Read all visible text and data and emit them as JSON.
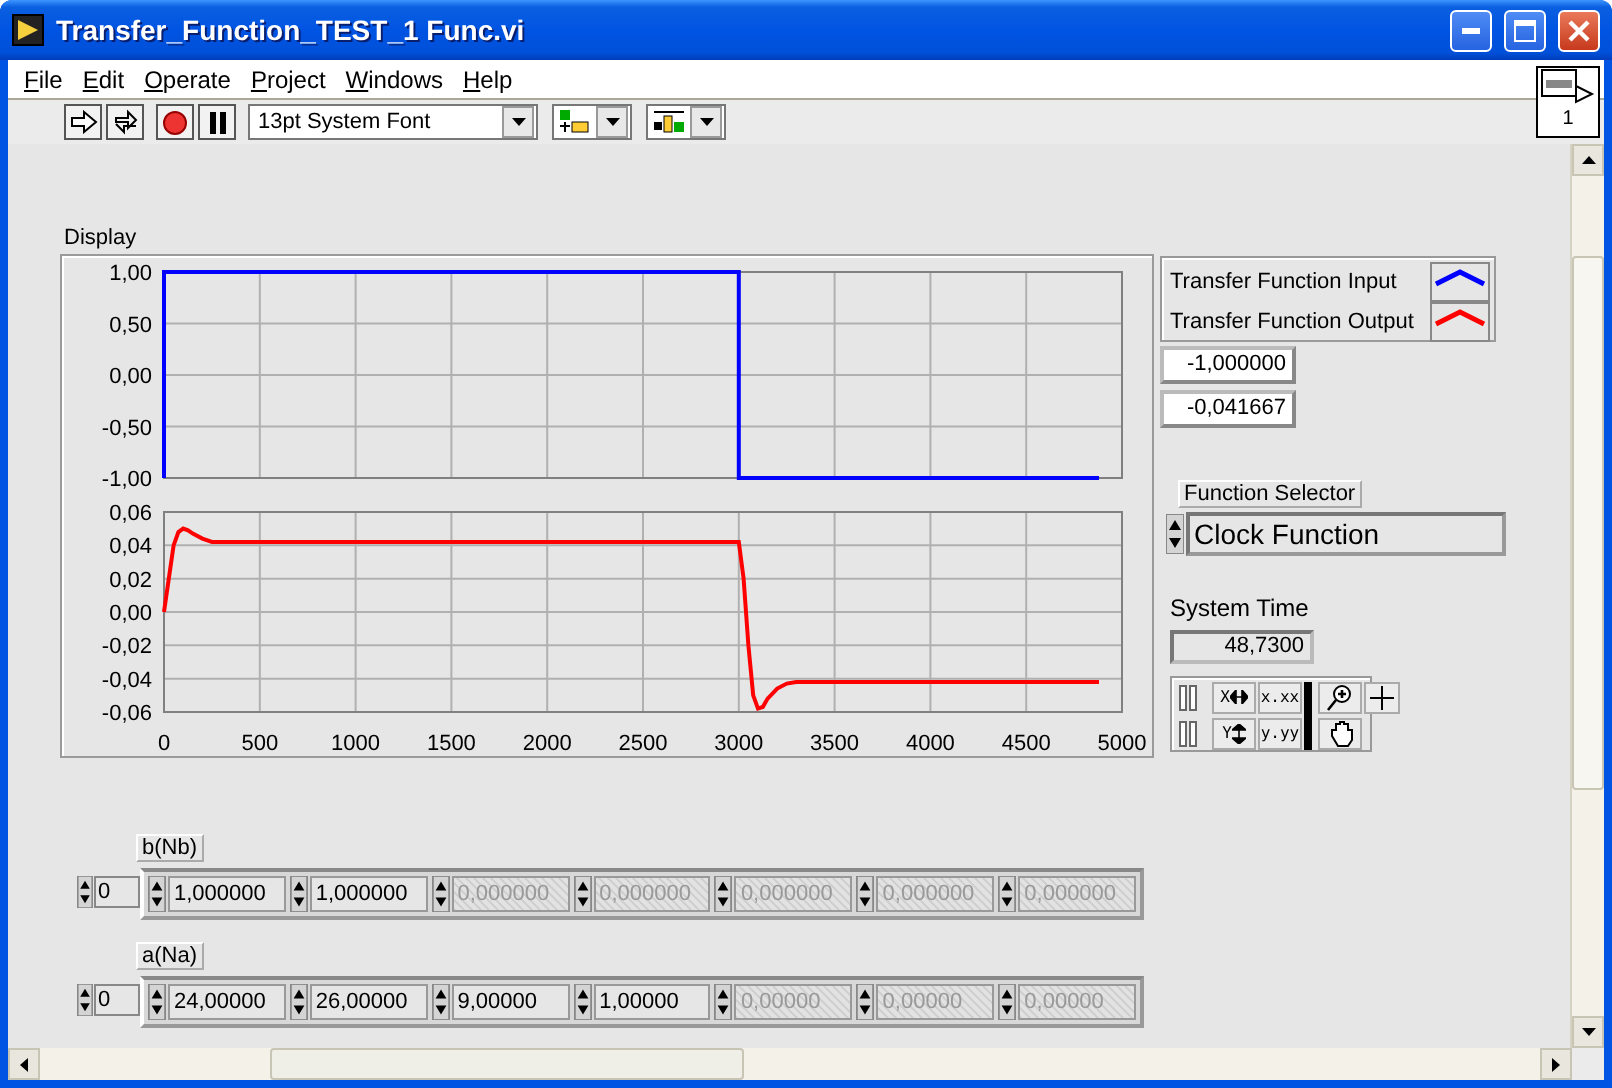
{
  "window": {
    "title": "Transfer_Function_TEST_1 Func.vi"
  },
  "menu": [
    "File",
    "Edit",
    "Operate",
    "Project",
    "Windows",
    "Help"
  ],
  "toolbar": {
    "font": "13pt System Font"
  },
  "vi_icon": {
    "label": "1"
  },
  "display": {
    "label": "Display",
    "plots": [
      {
        "chart_data": {
          "type": "line",
          "grid": true,
          "xlim": [
            0,
            5000
          ],
          "ylim": [
            -1,
            1
          ],
          "yticks": [
            {
              "value": 1,
              "label": "1,00"
            },
            {
              "value": 0.5,
              "label": "0,50"
            },
            {
              "value": 0,
              "label": "0,00"
            },
            {
              "value": -0.5,
              "label": "-0,50"
            },
            {
              "value": -1,
              "label": "-1,00"
            }
          ],
          "x": [
            0,
            0,
            3000,
            3000,
            4880
          ],
          "series": [
            {
              "name": "Transfer Function Input",
              "color": "#0000ff",
              "values": [
                -1,
                1,
                1,
                -1,
                -1
              ]
            }
          ]
        }
      },
      {
        "chart_data": {
          "type": "line",
          "grid": true,
          "xlim": [
            0,
            5000
          ],
          "ylim": [
            -0.06,
            0.06
          ],
          "xticks": [
            0,
            500,
            1000,
            1500,
            2000,
            2500,
            3000,
            3500,
            4000,
            4500,
            5000
          ],
          "yticks": [
            {
              "value": 0.06,
              "label": "0,06"
            },
            {
              "value": 0.04,
              "label": "0,04"
            },
            {
              "value": 0.02,
              "label": "0,02"
            },
            {
              "value": 0,
              "label": "0,00"
            },
            {
              "value": -0.02,
              "label": "-0,02"
            },
            {
              "value": -0.04,
              "label": "-0,04"
            },
            {
              "value": -0.06,
              "label": "-0,06"
            }
          ],
          "x": [
            0,
            25,
            50,
            75,
            100,
            125,
            150,
            200,
            250,
            300,
            3000,
            3025,
            3050,
            3075,
            3100,
            3125,
            3150,
            3200,
            3250,
            3300,
            3400,
            4880
          ],
          "series": [
            {
              "name": "Transfer Function Output",
              "color": "#ff0000",
              "values": [
                0,
                0.02,
                0.04,
                0.048,
                0.05,
                0.049,
                0.047,
                0.044,
                0.042,
                0.042,
                0.042,
                0.02,
                -0.02,
                -0.05,
                -0.058,
                -0.057,
                -0.052,
                -0.046,
                -0.043,
                -0.042,
                -0.042,
                -0.042
              ]
            }
          ]
        }
      }
    ]
  },
  "cursor_readouts": [
    "-1,000000",
    "-0,041667"
  ],
  "function_selector": {
    "label": "Function Selector",
    "value": "Clock Function"
  },
  "system_time": {
    "label": "System Time",
    "value": "48,7300"
  },
  "graph_palette": {
    "x_scale": "X",
    "y_scale": "Y",
    "x_format": "x.xx",
    "y_format": "y.yy"
  },
  "arrays": [
    {
      "label": "b(Nb)",
      "index": "0",
      "elements": [
        {
          "value": "1,000000",
          "disabled": false
        },
        {
          "value": "1,000000",
          "disabled": false
        },
        {
          "value": "0,000000",
          "disabled": true
        },
        {
          "value": "0,000000",
          "disabled": true
        },
        {
          "value": "0,000000",
          "disabled": true
        },
        {
          "value": "0,000000",
          "disabled": true
        },
        {
          "value": "0,000000",
          "disabled": true
        }
      ]
    },
    {
      "label": "a(Na)",
      "index": "0",
      "elements": [
        {
          "value": "24,00000",
          "disabled": false
        },
        {
          "value": "26,00000",
          "disabled": false
        },
        {
          "value": "9,00000",
          "disabled": false
        },
        {
          "value": "1,00000",
          "disabled": false
        },
        {
          "value": "0,00000",
          "disabled": true
        },
        {
          "value": "0,00000",
          "disabled": true
        },
        {
          "value": "0,00000",
          "disabled": true
        }
      ]
    }
  ]
}
